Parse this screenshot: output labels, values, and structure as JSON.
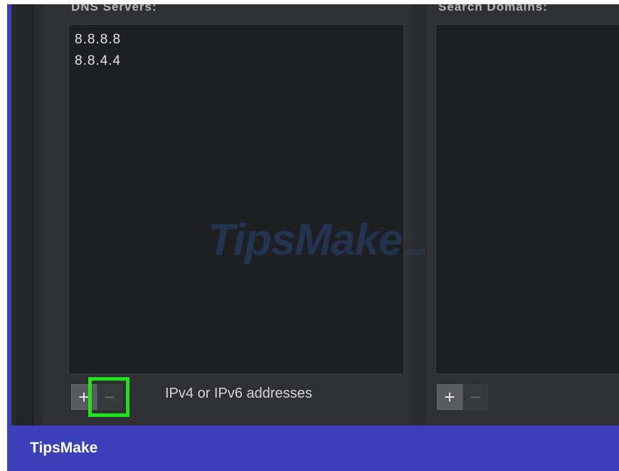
{
  "dns_servers": {
    "label": "DNS Servers:",
    "entries": [
      "8.8.8.8",
      "8.8.4.4"
    ],
    "add_label": "+",
    "remove_label": "−",
    "hint": "IPv4 or IPv6 addresses"
  },
  "search_domains": {
    "label": "Search Domains:",
    "add_label": "+",
    "remove_label": "−"
  },
  "watermark": {
    "text": "TipsMake",
    "suffix": ".com"
  },
  "footer": {
    "brand": "TipsMake"
  },
  "colors": {
    "frame": "#3b3fb8",
    "highlight": "#1ee31a"
  }
}
